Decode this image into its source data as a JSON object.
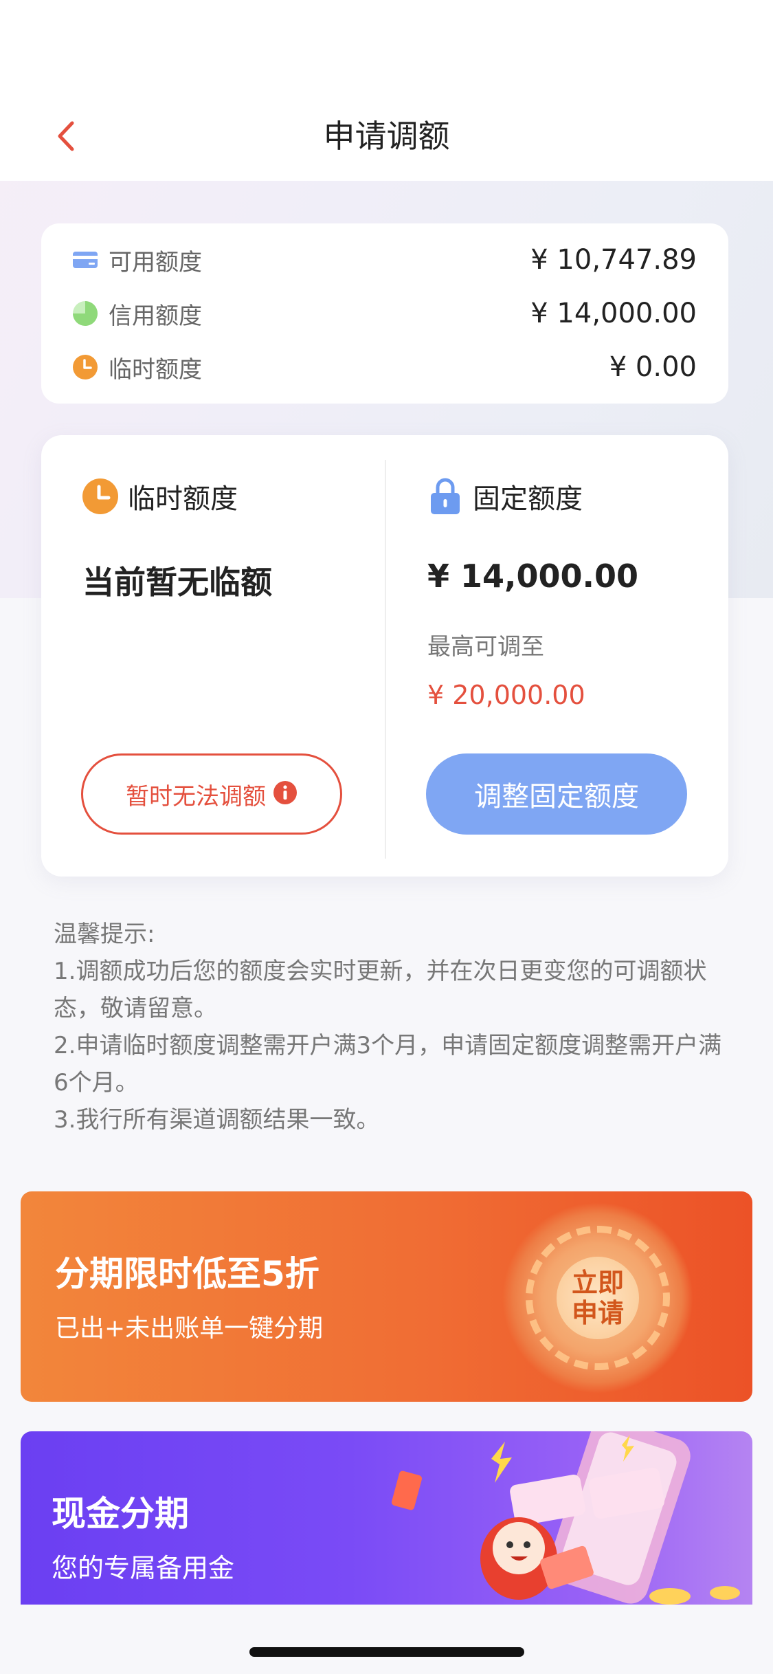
{
  "header": {
    "title": "申请调额"
  },
  "summary": {
    "rows": [
      {
        "label": "可用额度",
        "value": "¥ 10,747.89",
        "icon": "card-icon"
      },
      {
        "label": "信用额度",
        "value": "¥ 14,000.00",
        "icon": "pie-icon"
      },
      {
        "label": "临时额度",
        "value": "¥ 0.00",
        "icon": "clock-icon"
      }
    ]
  },
  "temp": {
    "title": "临时额度",
    "status": "当前暂无临额",
    "button": "暂时无法调额"
  },
  "fixed": {
    "title": "固定额度",
    "amount": "¥ 14,000.00",
    "max_label": "最高可调至",
    "max_amount": "¥ 20,000.00",
    "button": "调整固定额度"
  },
  "tips": {
    "title": "温馨提示:",
    "items": [
      "1.调额成功后您的额度会实时更新，并在次日更变您的可调额状态，敬请留意。",
      "2.申请临时额度调整需开户满3个月，申请固定额度调整需开户满6个月。",
      "3.我行所有渠道调额结果一致。"
    ]
  },
  "banner_installment": {
    "title": "分期限时低至5折",
    "subtitle": "已出+未出账单一键分期",
    "badge": "立即申请"
  },
  "banner_cash": {
    "title": "现金分期",
    "subtitle": "您的专属备用金"
  },
  "colors": {
    "accent_red": "#e4503e",
    "button_blue": "#7fa6f3",
    "clock_orange": "#f29a35",
    "lock_blue": "#6d9bf0",
    "pie_green": "#8fd97a"
  }
}
